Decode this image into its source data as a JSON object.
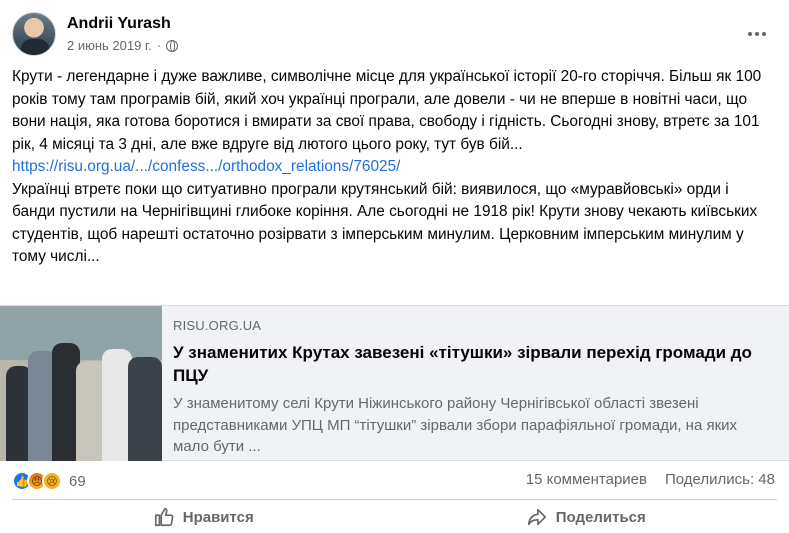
{
  "post": {
    "author": "Andrii Yurash",
    "date": "2 июнь 2019 г.",
    "separator": "·",
    "paragraph1": "Крути - легендарне і дуже важливе, символічне місце для української історії 20-го сторіччя. Більш як 100 років тому там програмів бій, який хоч українці програли, але довели - чи не вперше в новітні часи, що вони нація, яка готова боротися і вмирати за свої права, свободу і гідність. Сьогодні знову, втретє за 101 рік, 4 місяці та 3 дні, але вже вдруге від лютого цього року, тут був бій...",
    "link": "https://risu.org.ua/.../confess.../orthodox_relations/76025/",
    "paragraph2": "Українці втретє поки що ситуативно програли крутянський бій: виявилося, що «муравйовські» орди і банди пустили на Чернігівщині глибоке коріння. Але сьогодні не 1918 рік! Крути знову чекають київських студентів, щоб нарешті остаточно розірвати з імперським минулим. Церковним імперським минулим у тому числі..."
  },
  "link_card": {
    "domain": "RISU.ORG.UA",
    "title": "У знаменитих Крутах завезені «тітушки» зірвали перехід громади до ПЦУ",
    "description": "У знаменитому селі Крути Ніжинського району Чернігівської області звезені представниками УПЦ МП “тітушки” зірвали збори парафіяльної громади, на яких мало бути ..."
  },
  "stats": {
    "reactions_count": "69",
    "comments": "15 комментариев",
    "shares": "Поделились: 48"
  },
  "actions": {
    "like": "Нравится",
    "share": "Поделиться"
  },
  "colors": {
    "link": "#216fdb",
    "secondary_text": "#65676b",
    "card_bg": "#f0f2f5"
  }
}
